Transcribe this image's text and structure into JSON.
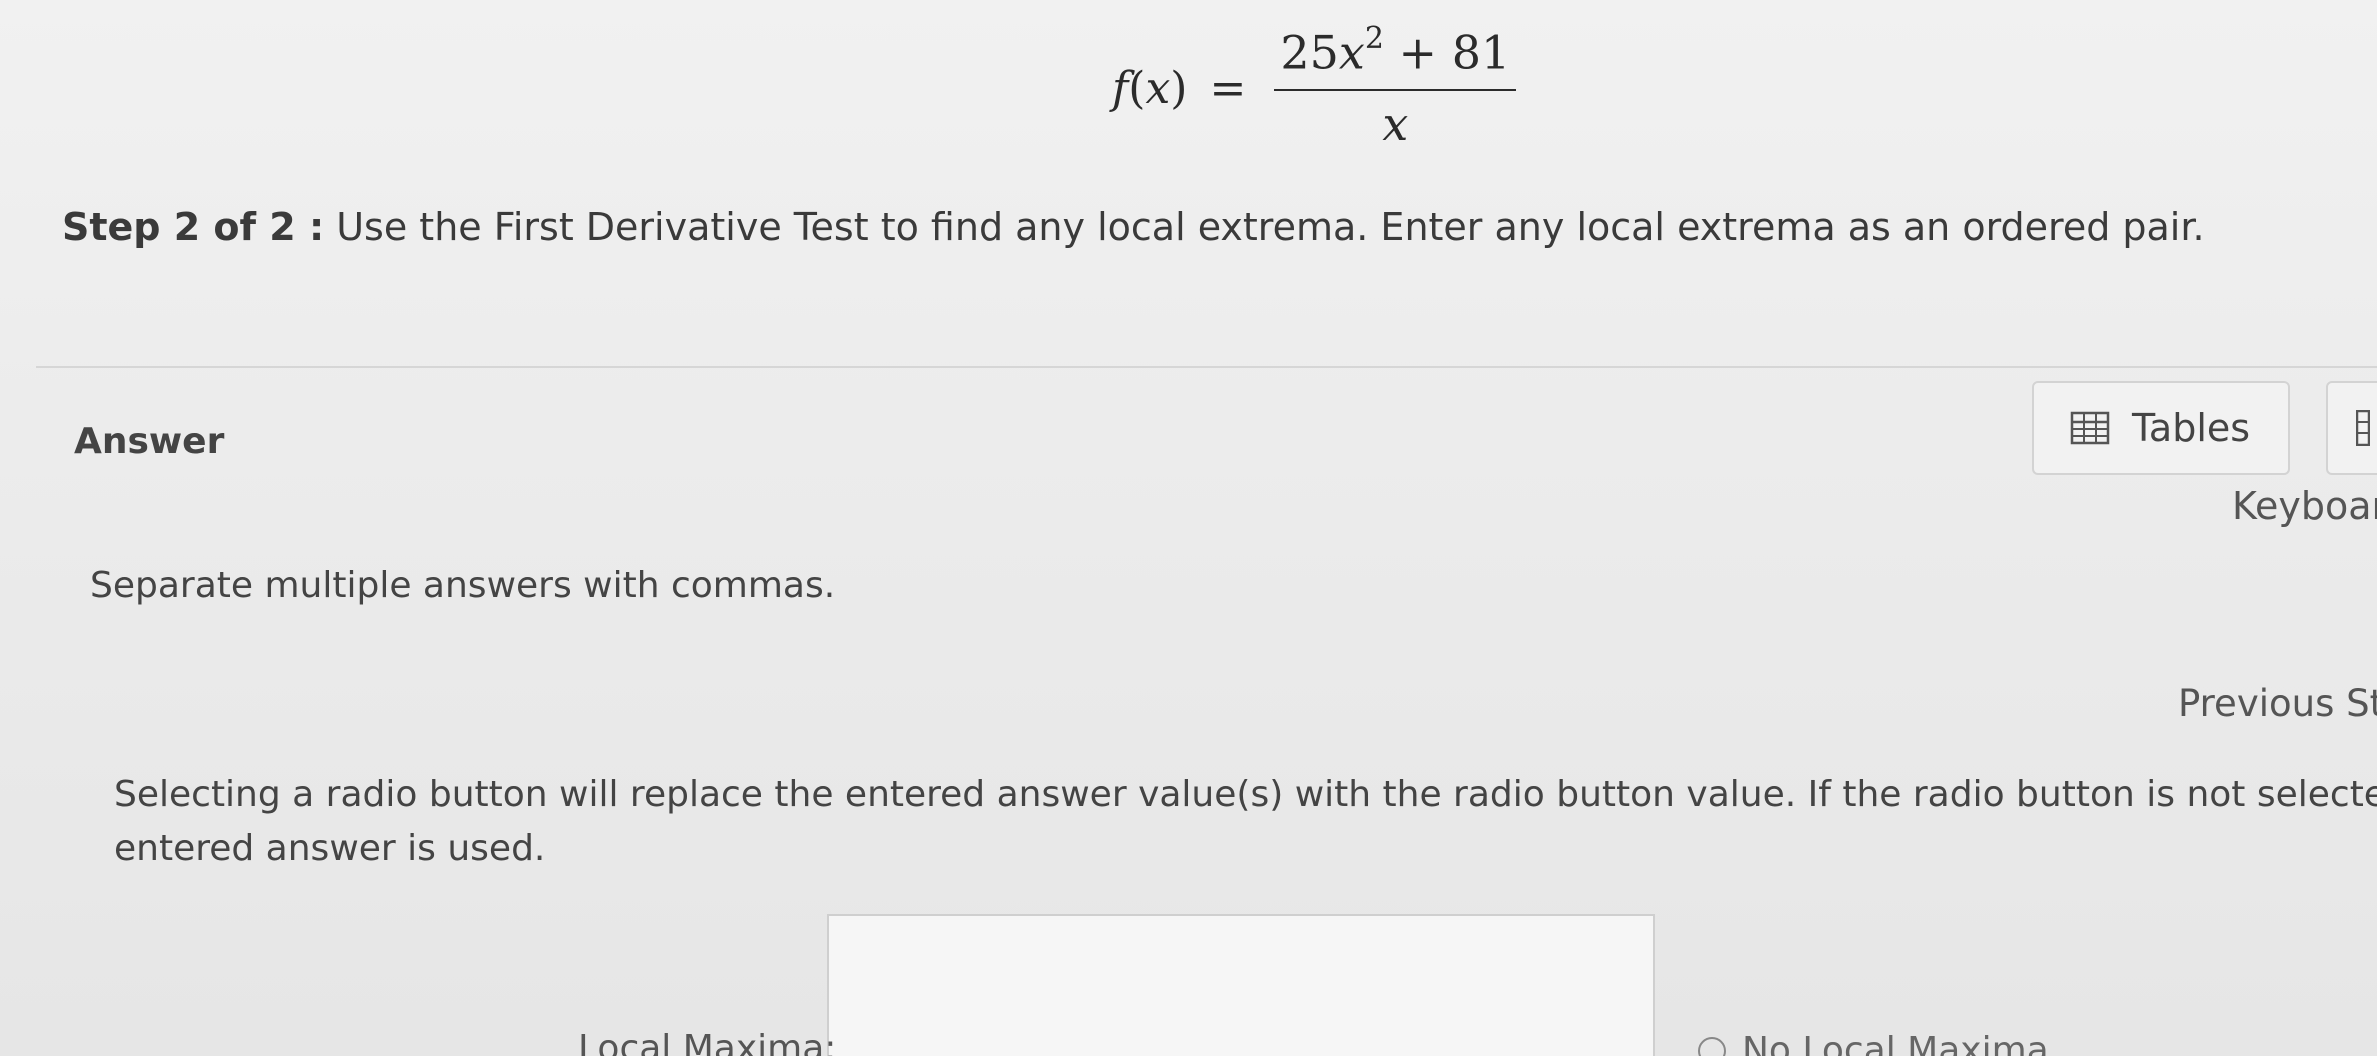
{
  "formula": {
    "lhs_name": "f",
    "lhs_arg_open": "(",
    "lhs_var": "x",
    "lhs_arg_close": ")",
    "equals": "=",
    "num_coef": "25",
    "num_var": "x",
    "num_exp": "2",
    "num_rest": " + 81",
    "den": "x"
  },
  "step": {
    "label": "Step 2 of 2 :",
    "instruction": "Use the First Derivative Test to find any local extrema. Enter any local extrema as an ordered pair."
  },
  "answer": {
    "label": "Answer",
    "tables_button": "Tables",
    "keyboard_label": "Keyboard",
    "separate_hint": "Separate multiple answers with commas.",
    "previous_step": "Previous Step Answers",
    "radio_note_line1": "Selecting a radio button will replace the entered answer value(s) with the radio button value. If the radio button is not selected, the",
    "radio_note_line2": "entered answer is used.",
    "local_maxima_label": "Local Maxima:",
    "local_maxima_value": "",
    "no_local_maxima_option": "No Local Maxima"
  },
  "icons": {
    "tables": "table-grid-icon",
    "keyboard": "keyboard-icon",
    "radio": "radio-unselected-icon"
  },
  "colors": {
    "background": "#ececec",
    "text": "#3a3a3a",
    "border": "#d3d3d3"
  }
}
